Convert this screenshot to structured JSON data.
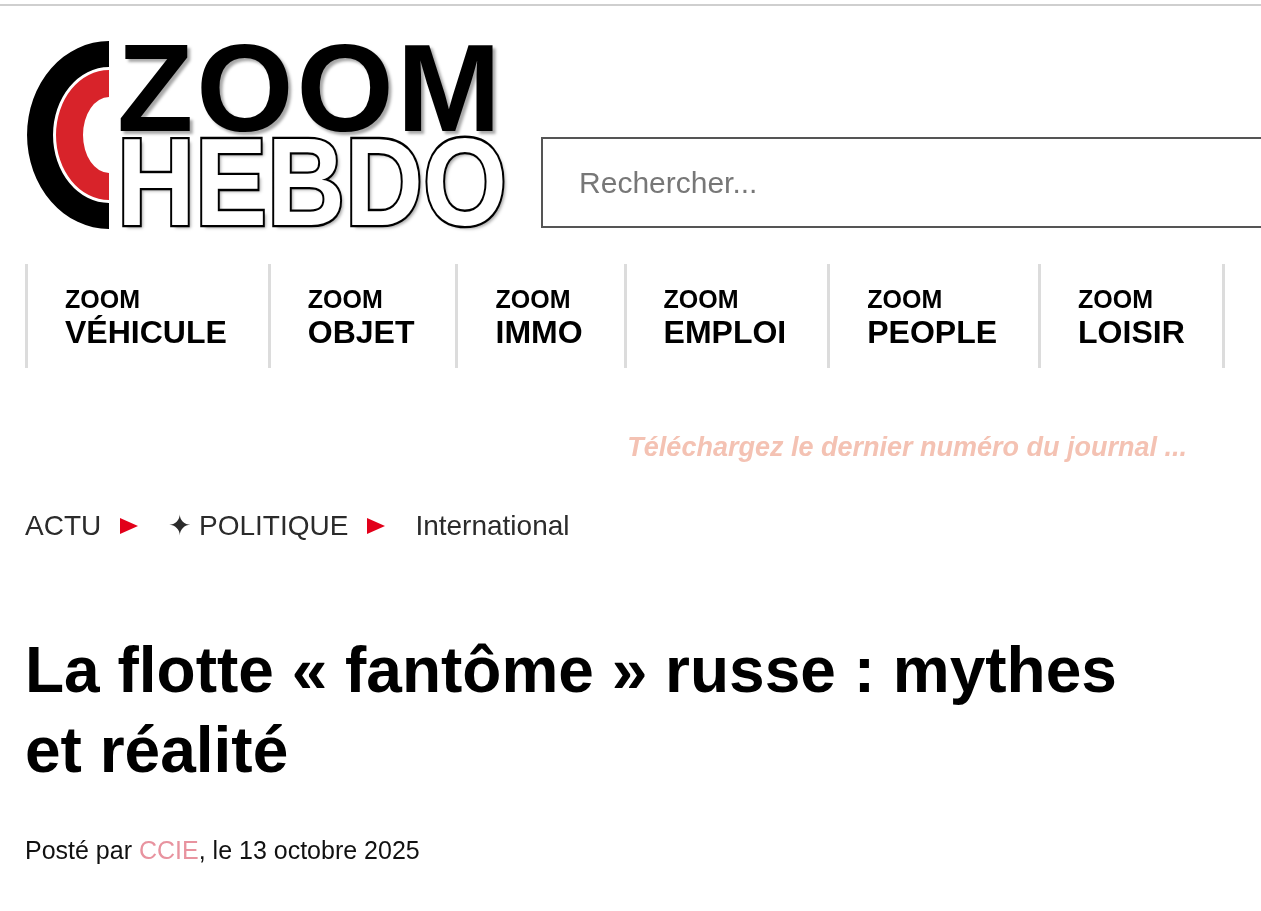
{
  "logo": {
    "line_1": "ZOOM",
    "line_2": "HEBDO"
  },
  "search": {
    "placeholder": "Rechercher..."
  },
  "nav": {
    "items": [
      {
        "prefix": "ZOOM",
        "label": "VÉHICULE"
      },
      {
        "prefix": "ZOOM",
        "label": "OBJET"
      },
      {
        "prefix": "ZOOM",
        "label": "IMMO"
      },
      {
        "prefix": "ZOOM",
        "label": "EMPLOI"
      },
      {
        "prefix": "ZOOM",
        "label": "PEOPLE"
      },
      {
        "prefix": "ZOOM",
        "label": "LOISIR"
      }
    ]
  },
  "download_link": "Téléchargez le dernier numéro du journal ...",
  "breadcrumb": [
    "ACTU",
    "✦ POLITIQUE",
    "International"
  ],
  "article": {
    "title": "La flotte « fantôme » russe : mythes et réalité",
    "byline": {
      "prefix": "Posté par ",
      "author": "CCIE",
      "suffix": ", le 13 octobre 2025"
    }
  }
}
